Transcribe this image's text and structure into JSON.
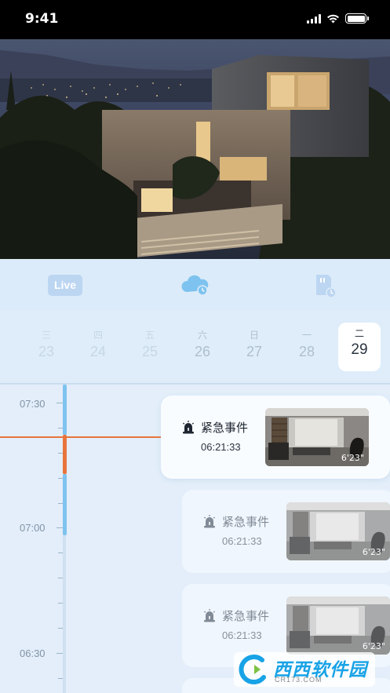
{
  "status_bar": {
    "time": "9:41"
  },
  "tabs": {
    "live_label": "Live"
  },
  "dates": [
    {
      "weekday": "三",
      "day": "23"
    },
    {
      "weekday": "四",
      "day": "24"
    },
    {
      "weekday": "五",
      "day": "25"
    },
    {
      "weekday": "六",
      "day": "26"
    },
    {
      "weekday": "日",
      "day": "27"
    },
    {
      "weekday": "一",
      "day": "28"
    },
    {
      "weekday": "二",
      "day": "29"
    }
  ],
  "timeline": {
    "labels": [
      "07:30",
      "07:00",
      "06:30"
    ]
  },
  "events": [
    {
      "title": "紧急事件",
      "time": "06:21:33",
      "duration": "6'23\""
    },
    {
      "title": "紧急事件",
      "time": "06:21:33",
      "duration": "6'23\""
    },
    {
      "title": "紧急事件",
      "time": "06:21:33",
      "duration": "6'23\""
    }
  ],
  "watermark": {
    "brand": "西西软件园",
    "domain": "CR173.COM"
  },
  "colors": {
    "accent_orange": "#e8743c",
    "accent_blue": "#7ec3ef",
    "background": "#e3eefa"
  }
}
